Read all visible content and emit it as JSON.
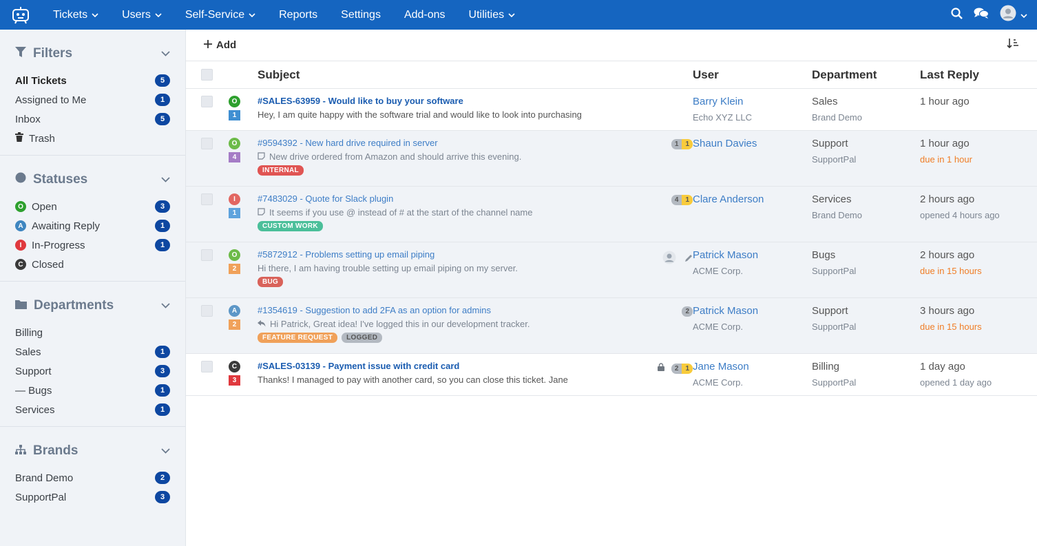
{
  "nav": {
    "tickets": "Tickets",
    "users": "Users",
    "self_service": "Self-Service",
    "reports": "Reports",
    "settings": "Settings",
    "addons": "Add-ons",
    "utilities": "Utilities"
  },
  "filters": {
    "title": "Filters",
    "items": [
      {
        "label": "All Tickets",
        "count": "5"
      },
      {
        "label": "Assigned to Me",
        "count": "1"
      },
      {
        "label": "Inbox",
        "count": "5"
      },
      {
        "label": "Trash",
        "count": ""
      }
    ]
  },
  "statuses": {
    "title": "Statuses",
    "items": [
      {
        "letter": "O",
        "label": "Open",
        "count": "3",
        "color": "#2ea02e"
      },
      {
        "letter": "A",
        "label": "Awaiting Reply",
        "count": "1",
        "color": "#3f86c0"
      },
      {
        "letter": "I",
        "label": "In-Progress",
        "count": "1",
        "color": "#e0393e"
      },
      {
        "letter": "C",
        "label": "Closed",
        "count": "",
        "color": "#3a3a3a"
      }
    ]
  },
  "departments": {
    "title": "Departments",
    "items": [
      {
        "label": "Billing",
        "count": ""
      },
      {
        "label": "Sales",
        "count": "1"
      },
      {
        "label": "Support",
        "count": "3"
      },
      {
        "label": "— Bugs",
        "count": "1"
      },
      {
        "label": "Services",
        "count": "1"
      }
    ]
  },
  "brands": {
    "title": "Brands",
    "items": [
      {
        "label": "Brand Demo",
        "count": "2"
      },
      {
        "label": "SupportPal",
        "count": "3"
      }
    ]
  },
  "toolbar": {
    "add_label": "Add"
  },
  "table": {
    "headers": {
      "subject": "Subject",
      "user": "User",
      "department": "Department",
      "last_reply": "Last Reply"
    },
    "rows": [
      {
        "status_letter": "O",
        "status_color": "#2ea02e",
        "priority": "1",
        "priority_color": "#3f8fd2",
        "subject": "#SALES-63959 - Would like to buy your software",
        "preview": "Hey, I am quite happy with the software trial and would like to look into purchasing",
        "user": "Barry Klein",
        "org": "Echo XYZ LLC",
        "dept": "Sales",
        "brand": "Brand Demo",
        "reply": "1 hour ago",
        "reply_sub": ""
      },
      {
        "status_letter": "O",
        "status_color": "#6dbb49",
        "priority": "4",
        "priority_color": "#a57cc6",
        "subject": "#9594392 - New hard drive required in server",
        "preview": "New drive ordered from Amazon and should arrive this evening.",
        "tags": [
          {
            "label": "INTERNAL",
            "color": "#e05553"
          }
        ],
        "pill": [
          "1",
          "1"
        ],
        "user": "Shaun Davies",
        "org": "",
        "dept": "Support",
        "brand": "SupportPal",
        "reply": "1 hour ago",
        "reply_sub": "due in 1 hour"
      },
      {
        "status_letter": "I",
        "status_color": "#e26762",
        "priority": "1",
        "priority_color": "#5ea3dd",
        "subject": "#7483029 - Quote for Slack plugin",
        "preview": "It seems if you use @ instead of # at the start of the channel name",
        "tags": [
          {
            "label": "CUSTOM WORK",
            "color": "#4bbf9a"
          }
        ],
        "pill": [
          "4",
          "1"
        ],
        "user": "Clare Anderson",
        "org": "",
        "dept": "Services",
        "brand": "Brand Demo",
        "reply": "2 hours ago",
        "reply_sub": "opened 4 hours ago"
      },
      {
        "status_letter": "O",
        "status_color": "#6dbb49",
        "priority": "2",
        "priority_color": "#f0a15a",
        "subject": "#5872912 - Problems setting up email piping",
        "preview": "Hi there, I am having trouble setting up email piping on my server.",
        "tags": [
          {
            "label": "BUG",
            "color": "#d9625a"
          }
        ],
        "user": "Patrick Mason",
        "org": "ACME Corp.",
        "dept": "Bugs",
        "brand": "SupportPal",
        "reply": "2 hours ago",
        "reply_sub": "due in 15 hours"
      },
      {
        "status_letter": "A",
        "status_color": "#5d97c7",
        "priority": "2",
        "priority_color": "#f0a15a",
        "subject": "#1354619 - Suggestion to add 2FA as an option for admins",
        "preview": "Hi Patrick, Great idea! I've logged this in our development tracker.",
        "tags": [
          {
            "label": "FEATURE REQUEST",
            "color": "#f0a15a"
          },
          {
            "label": "LOGGED",
            "color": "#b3b9c1"
          }
        ],
        "pill": [
          "2"
        ],
        "user": "Patrick Mason",
        "org": "ACME Corp.",
        "dept": "Support",
        "brand": "SupportPal",
        "reply": "3 hours ago",
        "reply_sub": "due in 15 hours"
      },
      {
        "status_letter": "C",
        "status_color": "#3a3a3a",
        "priority": "3",
        "priority_color": "#e0393e",
        "subject": "#SALES-03139 - Payment issue with credit card",
        "preview": "Thanks! I managed to pay with another card, so you can close this ticket. Jane",
        "pill": [
          "2",
          "1"
        ],
        "user": "Jane Mason",
        "org": "ACME Corp.",
        "dept": "Billing",
        "brand": "SupportPal",
        "reply": "1 day ago",
        "reply_sub": "opened 1 day ago"
      }
    ]
  }
}
